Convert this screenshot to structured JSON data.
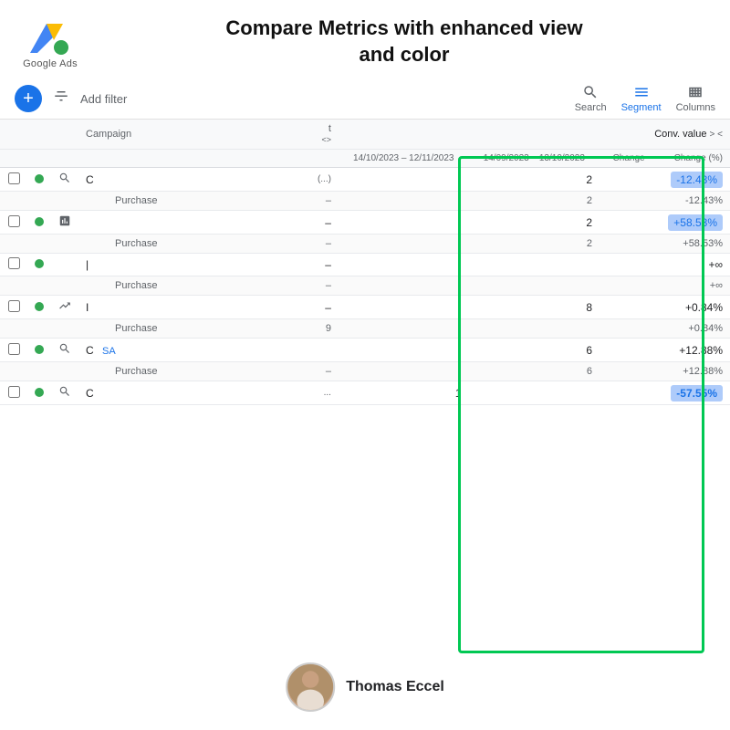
{
  "header": {
    "logo_text": "Google Ads",
    "title_line1": "Compare Metrics with enhanced view",
    "title_line2": "and color"
  },
  "toolbar": {
    "add_button_label": "+",
    "filter_label": "Add filter",
    "search_label": "Search",
    "segment_label": "Segment",
    "columns_label": "Columns"
  },
  "table": {
    "col_headers": {
      "campaign": "Campaign",
      "col_t": "t",
      "conv_value": "Conv. value",
      "date1": "14/10/2023 – 12/11/2023",
      "date2": "14/09/2023 – 13/10/2023",
      "change": "Change",
      "change_pct": "Change (%)"
    },
    "rows": [
      {
        "type": "campaign",
        "name": "C",
        "icon": "search",
        "val_col": "(...)",
        "date1_val": "",
        "date2_val": "2",
        "change": "",
        "change_pct": "-12.43%",
        "change_pct_badge": true,
        "badge_color": "blue",
        "sub": {
          "label": "Purchase",
          "date1_val": "–",
          "date2_val": "2",
          "change": "",
          "change_pct": "-12.43%"
        }
      },
      {
        "type": "campaign",
        "name": "",
        "icon": "chart",
        "val_col": "–",
        "date1_val": "",
        "date2_val": "2",
        "change": "",
        "change_pct": "+58.53%",
        "change_pct_badge": true,
        "badge_color": "blue",
        "sub": {
          "label": "Purchase",
          "date1_val": "–",
          "date2_val": "2",
          "change": "",
          "change_pct": "+58.53%"
        }
      },
      {
        "type": "campaign",
        "name": "|",
        "icon": "none",
        "val_col": "–",
        "date1_val": "",
        "date2_val": "",
        "change": "",
        "change_pct": "+∞",
        "sub": {
          "label": "Purchase",
          "date1_val": "–",
          "date2_val": "",
          "change": "",
          "change_pct": "+∞"
        }
      },
      {
        "type": "campaign",
        "name": "I",
        "icon": "trend",
        "val_col": "–",
        "date1_val": "9",
        "date2_val": "8",
        "change": "",
        "change_pct": "+0.84%",
        "sub": {
          "label": "Purchase",
          "date1_val": "9",
          "date2_val": "",
          "change": "",
          "change_pct": "+0.84%"
        }
      },
      {
        "type": "campaign",
        "name": "C",
        "icon": "search",
        "sa_badge": "SA",
        "val_col": "",
        "date1_val": "",
        "date2_val": "6",
        "change": "",
        "change_pct": "+12.88%",
        "sub": {
          "label": "Purchase",
          "date1_val": "–",
          "date2_val": "6",
          "change": "",
          "change_pct": "+12.88%"
        }
      },
      {
        "type": "campaign",
        "name": "C",
        "icon": "search",
        "val_col": "...",
        "date1_val": "1",
        "date2_val": "",
        "change": "",
        "change_pct": "-57.55%",
        "change_pct_badge": true,
        "badge_color": "blue"
      }
    ]
  },
  "profile": {
    "name": "Thomas Eccel"
  }
}
